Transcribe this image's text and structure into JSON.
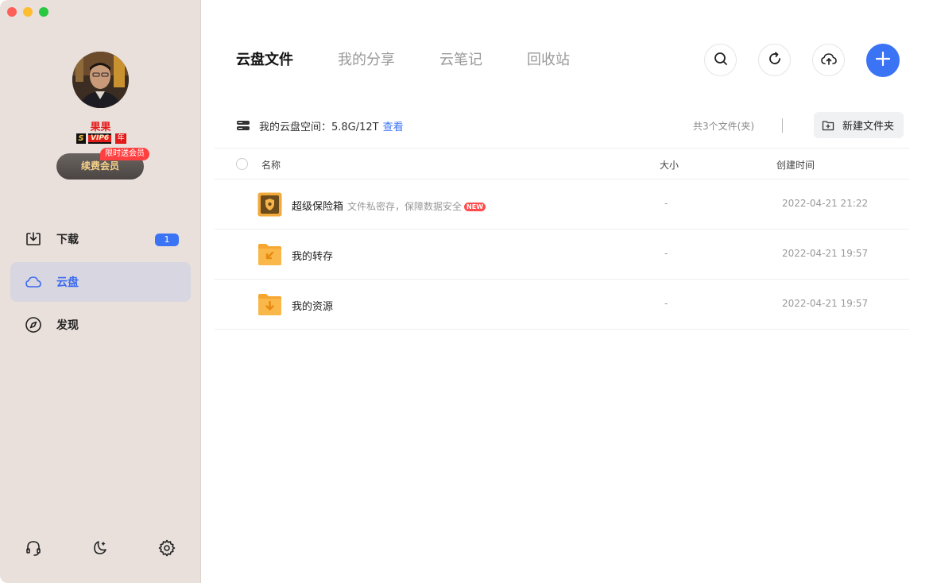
{
  "sidebar": {
    "username": "果果",
    "vip": {
      "s": "S",
      "label": "VIP6",
      "year": "年"
    },
    "promo_tag": "限时送会员",
    "renew_button": "续费会员",
    "nav": [
      {
        "label": "下载",
        "icon": "download-icon",
        "badge": "1"
      },
      {
        "label": "云盘",
        "icon": "cloud-icon",
        "active": true
      },
      {
        "label": "发现",
        "icon": "compass-icon"
      }
    ],
    "bottom_icons": [
      "headset-icon",
      "moon-icon",
      "gear-icon"
    ]
  },
  "main": {
    "tabs": [
      {
        "label": "云盘文件",
        "active": true
      },
      {
        "label": "我的分享"
      },
      {
        "label": "云笔记"
      },
      {
        "label": "回收站"
      }
    ],
    "storage": {
      "label": "我的云盘空间：5.8G/12T",
      "link": "查看",
      "file_count": "共3个文件(夹)",
      "new_folder": "新建文件夹"
    },
    "columns": {
      "name": "名称",
      "size": "大小",
      "time": "创建时间"
    },
    "files": [
      {
        "name": "超级保险箱",
        "desc": "文件私密存，保障数据安全",
        "tag": "NEW",
        "size": "-",
        "time": "2022-04-21 21:22",
        "icon": "safe-box-icon"
      },
      {
        "name": "我的转存",
        "size": "-",
        "time": "2022-04-21 19:57",
        "icon": "folder-transfer-icon"
      },
      {
        "name": "我的资源",
        "size": "-",
        "time": "2022-04-21 19:57",
        "icon": "folder-download-icon"
      }
    ]
  },
  "colors": {
    "accent": "#3b73f5",
    "sidebar_bg": "#e9e0db",
    "folder": "#f7a630",
    "vip_red": "#e51c1c"
  }
}
